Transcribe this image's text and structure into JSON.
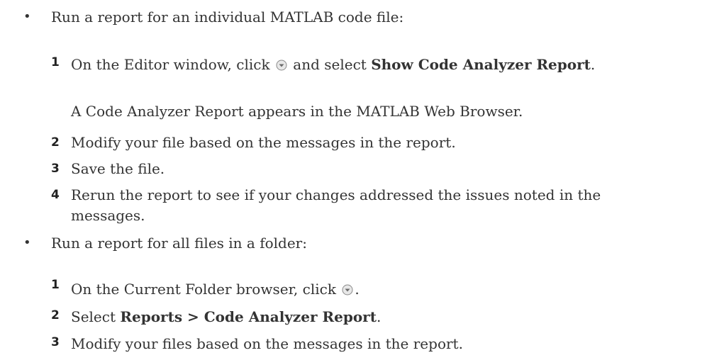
{
  "bullet_glyph": "•",
  "section1": {
    "intro": "Run a report for an individual MATLAB code file:",
    "steps": [
      {
        "num": "1",
        "before": "On the Editor window, click",
        "icon": "dropdown-arrow-icon",
        "middle": "and select",
        "bold": "Show Code Analyzer Report",
        "after": "."
      },
      {
        "num": "",
        "note": "A Code Analyzer Report appears in the MATLAB Web Browser."
      },
      {
        "num": "2",
        "text": "Modify your file based on the messages in the report."
      },
      {
        "num": "3",
        "text": "Save the file."
      },
      {
        "num": "4",
        "text_line1": "Rerun the report to see if your changes addressed the issues noted in the",
        "text_line2": "messages."
      }
    ]
  },
  "section2": {
    "intro": "Run a report for all files in a folder:",
    "steps": [
      {
        "num": "1",
        "before": "On the Current Folder browser, click",
        "icon": "dropdown-arrow-icon",
        "after": "."
      },
      {
        "num": "2",
        "before": "Select",
        "bold": "Reports > Code Analyzer Report",
        "after": "."
      },
      {
        "num": "3",
        "text": "Modify your files based on the messages in the report."
      }
    ]
  },
  "colors": {
    "text": "#333333",
    "icon_fill": "#e8e8e8",
    "icon_stroke": "#8a8a8a"
  }
}
